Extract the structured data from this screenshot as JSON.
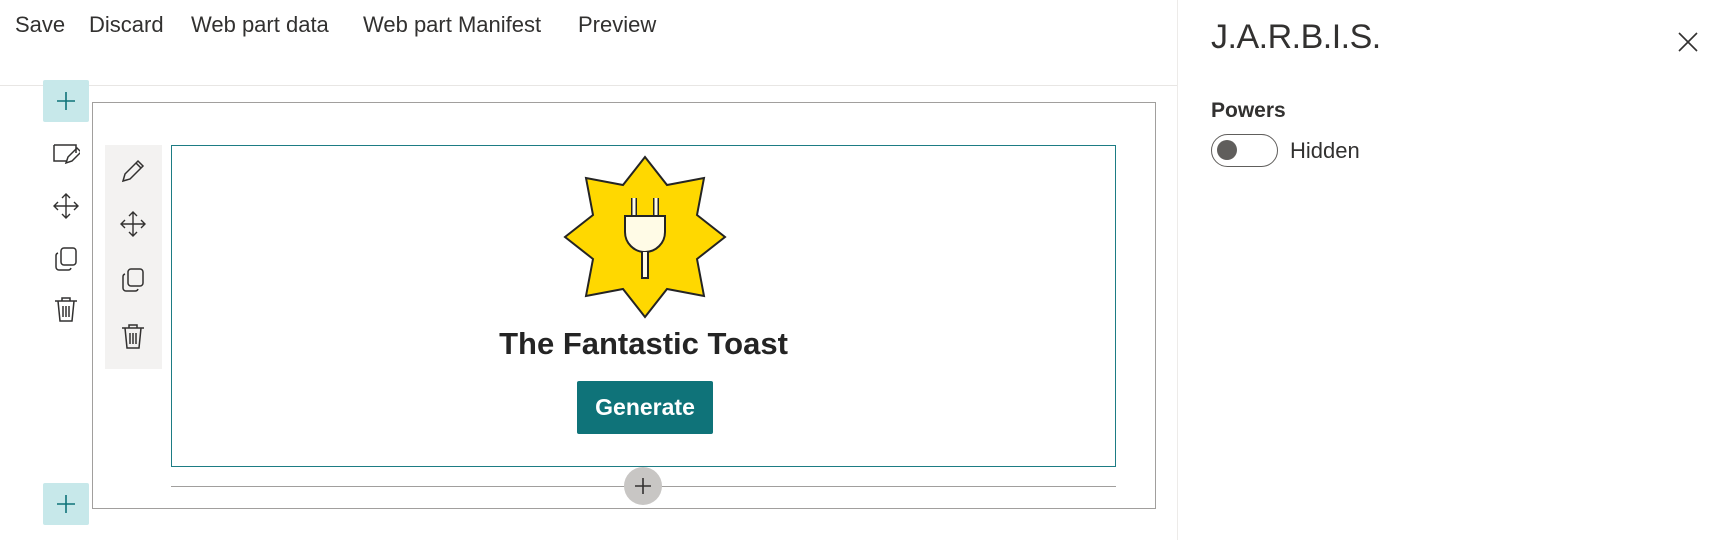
{
  "commandbar": {
    "save": "Save",
    "discard": "Discard",
    "webpart_data": "Web part data",
    "webpart_manifest": "Web part Manifest",
    "preview": "Preview"
  },
  "section_toolbar": {
    "icons": [
      "add-icon",
      "edit-section-icon",
      "move-icon",
      "duplicate-icon",
      "delete-icon"
    ]
  },
  "webpart_toolbar": {
    "icons": [
      "edit-icon",
      "move-icon",
      "duplicate-icon",
      "delete-icon"
    ]
  },
  "webpart": {
    "icon": "plug-star-icon",
    "title": "The Fantastic Toast",
    "button_label": "Generate"
  },
  "property_pane": {
    "title": "J.A.R.B.I.S.",
    "field_label": "Powers",
    "toggle_state": "Hidden",
    "toggle_on": false
  },
  "colors": {
    "accent": "#0f7379",
    "add_button_bg": "#c7e8ea",
    "star_fill": "#ffd800"
  }
}
